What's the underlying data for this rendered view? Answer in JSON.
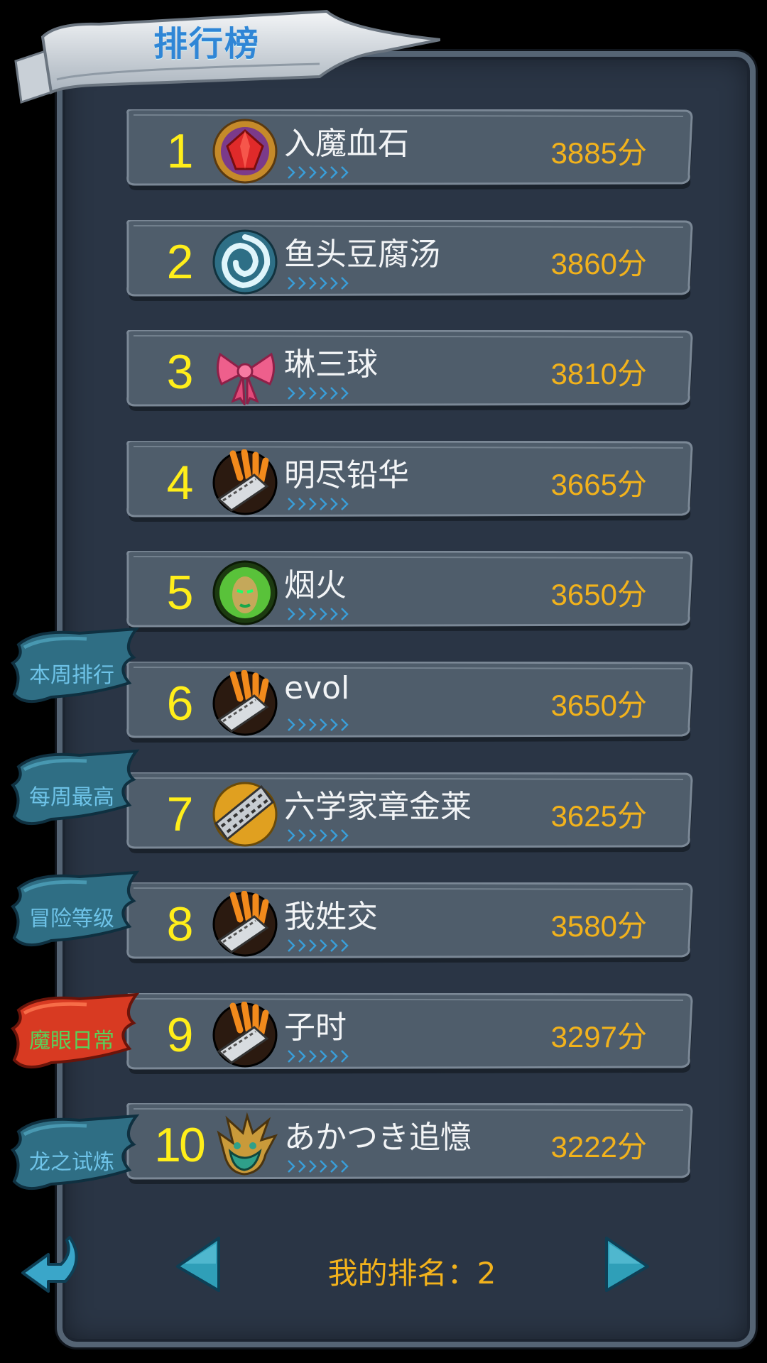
{
  "header": {
    "title": "排行榜"
  },
  "colors": {
    "rank": "#ffee1a",
    "score": "#f2b21c",
    "name": "#f2f4f6",
    "tab_text": "#6ec3e8",
    "tab_active_text": "#58d25a"
  },
  "rankings": [
    {
      "rank": "1",
      "name": "入魔血石",
      "score": "3885分",
      "icon": "red-gem-icon"
    },
    {
      "rank": "2",
      "name": "鱼头豆腐汤",
      "score": "3860分",
      "icon": "swirl-emblem-icon"
    },
    {
      "rank": "3",
      "name": "琳三球",
      "score": "3810分",
      "icon": "pink-bow-icon"
    },
    {
      "rank": "4",
      "name": "明尽铅华",
      "score": "3665分",
      "icon": "claw-blade-icon"
    },
    {
      "rank": "5",
      "name": "烟火",
      "score": "3650分",
      "icon": "green-face-icon"
    },
    {
      "rank": "6",
      "name": "evol",
      "score": "3650分",
      "icon": "claw-blade-icon"
    },
    {
      "rank": "7",
      "name": "六学家章金莱",
      "score": "3625分",
      "icon": "striped-blade-icon"
    },
    {
      "rank": "8",
      "name": "我姓交",
      "score": "3580分",
      "icon": "claw-blade-icon"
    },
    {
      "rank": "9",
      "name": "子时",
      "score": "3297分",
      "icon": "claw-blade-icon"
    },
    {
      "rank": "10",
      "name": "あかつき追憶",
      "score": "3222分",
      "icon": "dragon-mask-icon"
    }
  ],
  "tabs": [
    {
      "label": "本周排行",
      "active": false
    },
    {
      "label": "每周最高",
      "active": false
    },
    {
      "label": "冒险等级",
      "active": false
    },
    {
      "label": "魔眼日常",
      "active": true
    },
    {
      "label": "龙之试炼",
      "active": false
    }
  ],
  "footer": {
    "my_rank_label": "我的排名：2"
  }
}
